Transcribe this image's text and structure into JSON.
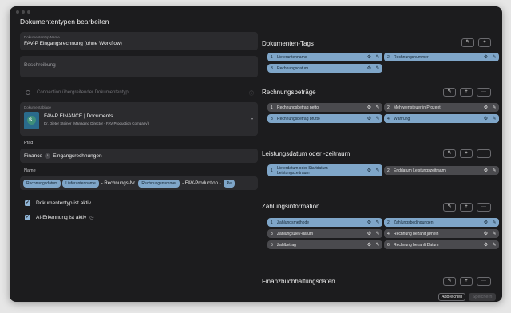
{
  "window": {
    "title": "Dokumententypen bearbeiten"
  },
  "form": {
    "name_label": "Dokumententyp Name",
    "name_value": "FAV-P Eingangsrechnung (ohne Workflow)",
    "description_placeholder": "Beschreibung",
    "connection_label": "Connection übergreifender Dokumententyp",
    "docs_label": "Dokumentablage",
    "docs_name": "FAV-P FINANCE | Documents",
    "docs_sub": "Dr. Dieter Steiner (Managing Director - FAV Production Company)",
    "docs_icon_letter": "S",
    "pfad_label": "Pfad",
    "pfad_root": "Finance",
    "pfad_child": "Eingangsrechnungen",
    "name_field_label": "Name",
    "name_parts": {
      "c1": "Rechnungsdatum",
      "c2": "Lieferantenname",
      "t1": "- Rechnungs-Nr.",
      "c3": "Rechnungsnummer",
      "t2": "- FAV-Production -",
      "c4": "Re"
    },
    "check_active": "Dokumententyp ist aktiv",
    "check_ai": "AI-Erkennung ist aktiv"
  },
  "sections": {
    "tags": {
      "title": "Dokumenten-Tags",
      "items": [
        {
          "num": "1",
          "label": "Lieferantenname"
        },
        {
          "num": "2",
          "label": "Rechnungsnummer"
        },
        {
          "num": "3",
          "label": "Rechnungsdatum"
        }
      ]
    },
    "amounts": {
      "title": "Rechnungsbeträge",
      "items": [
        {
          "num": "1",
          "label": "Rechnungsbetrag netto"
        },
        {
          "num": "2",
          "label": "Mehrwertsteuer in Prozent"
        },
        {
          "num": "3",
          "label": "Rechnungsbetrag brutto"
        },
        {
          "num": "4",
          "label": "Währung"
        }
      ]
    },
    "service": {
      "title": "Leistungsdatum oder -zeitraum",
      "items": [
        {
          "num": "1",
          "label_line1": "Lieferdatum oder Startdatum",
          "label_line2": "Leistungszeitraum"
        },
        {
          "num": "2",
          "label": "Enddatum Leistungszeitraum"
        }
      ]
    },
    "payment": {
      "title": "Zahlungsinformation",
      "items": [
        {
          "num": "1",
          "label": "Zahlungsmethode"
        },
        {
          "num": "2",
          "label": "Zahlungsbedingungen"
        },
        {
          "num": "3",
          "label": "Zahlungsziel/-datum"
        },
        {
          "num": "4",
          "label": "Rechnung bezahlt ja/nein"
        },
        {
          "num": "5",
          "label": "Zahlbetrag"
        },
        {
          "num": "6",
          "label": "Rechnung bezahlt Datum"
        }
      ]
    },
    "accounting": {
      "title": "Finanzbuchhaltungsdaten"
    }
  },
  "buttons": {
    "edit": "✎",
    "add": "+",
    "more": "···",
    "cancel": "Abbrechen",
    "save": "Speichern"
  },
  "colors": {
    "tag_active": "#7fa6c9",
    "tag_inactive": "#4a4a4e",
    "panel": "#2b2b2e",
    "background": "#1c1c1e"
  }
}
